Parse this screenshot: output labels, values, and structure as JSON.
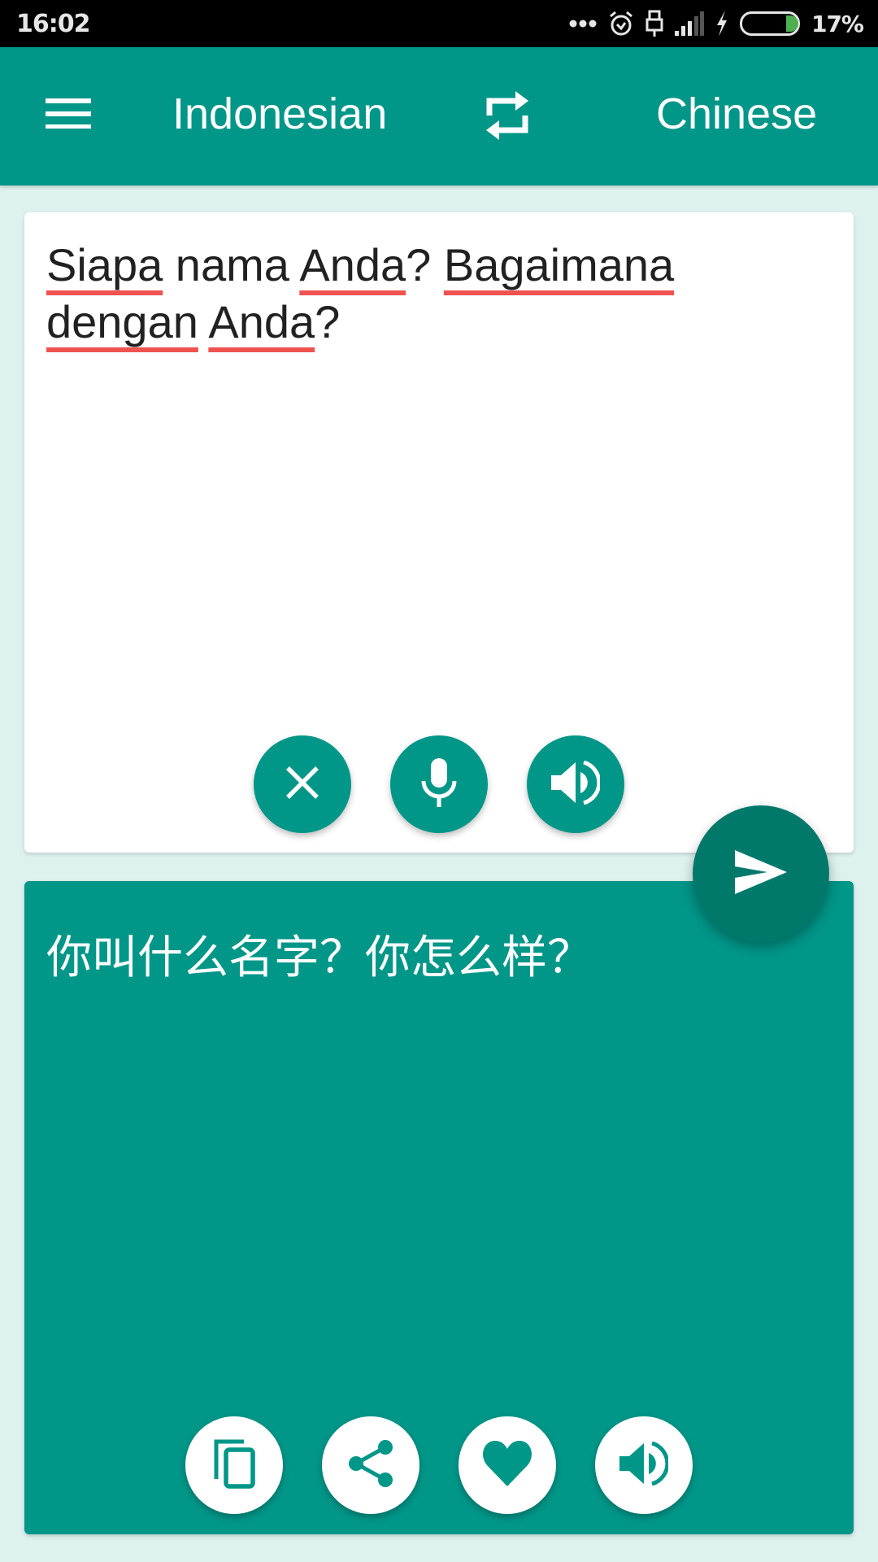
{
  "status_bar": {
    "time": "16:02",
    "battery_percent": "17%",
    "battery_level": 0.17,
    "icons": [
      "more-dots-icon",
      "alarm-icon",
      "usb-icon",
      "signal-icon",
      "charging-bolt-icon",
      "battery-icon"
    ]
  },
  "app_bar": {
    "menu_icon": "hamburger-menu-icon",
    "source_language": "Indonesian",
    "swap_icon": "swap-languages-icon",
    "target_language": "Chinese"
  },
  "input": {
    "words": [
      {
        "text": "Siapa",
        "misspelled": true
      },
      {
        "text": " nama ",
        "misspelled": false
      },
      {
        "text": "Anda",
        "misspelled": true
      },
      {
        "text": "? ",
        "misspelled": false
      },
      {
        "text": "Bagaimana",
        "misspelled": true
      },
      {
        "text": " ",
        "misspelled": false
      },
      {
        "text": "dengan",
        "misspelled": true
      },
      {
        "text": " ",
        "misspelled": false
      },
      {
        "text": "Anda",
        "misspelled": true
      },
      {
        "text": "?",
        "misspelled": false
      }
    ],
    "full_text": "Siapa nama Anda? Bagaimana dengan Anda?",
    "buttons": [
      {
        "name": "clear",
        "icon": "close-icon"
      },
      {
        "name": "voice-input",
        "icon": "microphone-icon"
      },
      {
        "name": "speak-input",
        "icon": "speaker-icon"
      }
    ]
  },
  "translate_fab": {
    "icon": "send-icon"
  },
  "output": {
    "text": "你叫什么名字？你怎么样？",
    "buttons": [
      {
        "name": "copy",
        "icon": "copy-icon"
      },
      {
        "name": "share",
        "icon": "share-icon"
      },
      {
        "name": "favorite",
        "icon": "heart-icon"
      },
      {
        "name": "speak-output",
        "icon": "speaker-icon"
      }
    ]
  },
  "colors": {
    "primary": "#009688",
    "primary_dark": "#00796b",
    "background": "#ddf1ee",
    "spellcheck_underline": "#ef5350",
    "battery_fill": "#4caf50"
  }
}
